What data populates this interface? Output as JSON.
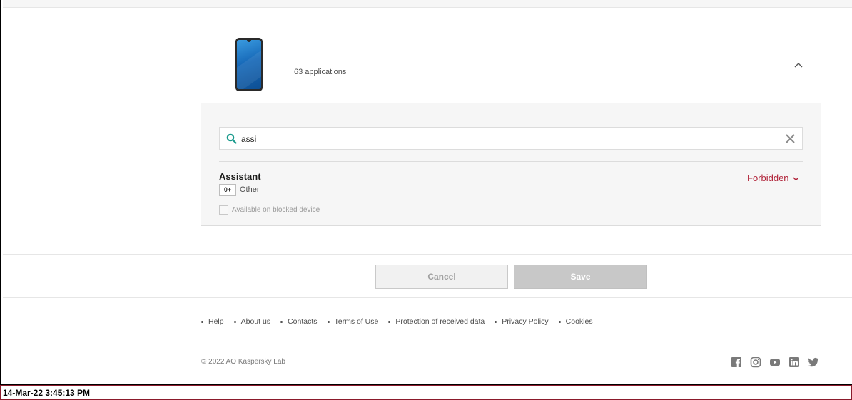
{
  "device": {
    "app_count": "63 applications"
  },
  "search": {
    "value": "assi"
  },
  "app": {
    "name": "Assistant",
    "age_rating": "0+",
    "category": "Other",
    "status": "Forbidden",
    "available_label": "Available on blocked device"
  },
  "actions": {
    "cancel_label": "Cancel",
    "save_label": "Save"
  },
  "footer": {
    "links": [
      "Help",
      "About us",
      "Contacts",
      "Terms of Use",
      "Protection of received data",
      "Privacy Policy",
      "Cookies"
    ],
    "copyright": "© 2022 AO Kaspersky Lab",
    "social_icons": [
      "facebook-icon",
      "instagram-icon",
      "youtube-icon",
      "linkedin-icon",
      "twitter-icon"
    ]
  },
  "colors": {
    "forbidden": "#b1243a",
    "search_icon": "#1a9a8c"
  },
  "timestamp": "14-Mar-22 3:45:13 PM"
}
